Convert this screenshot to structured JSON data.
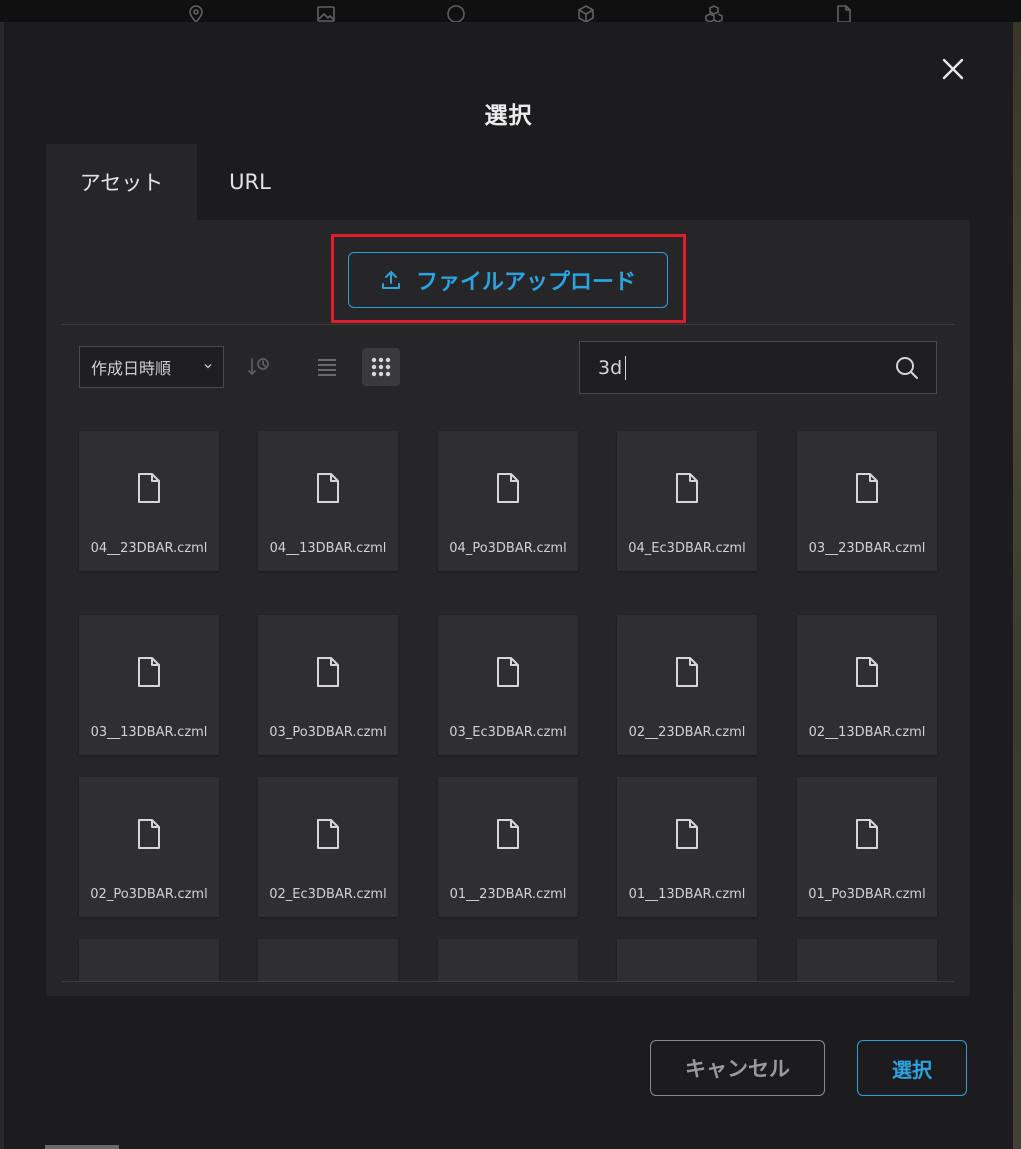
{
  "background": {
    "toolbar_icons": [
      "map-pin-icon",
      "image-icon",
      "circle-icon",
      "box-icon",
      "cubes-icon",
      "file-icon"
    ]
  },
  "modal": {
    "title": "選択",
    "tabs": [
      {
        "label": "アセット",
        "active": true
      },
      {
        "label": "URL",
        "active": false
      }
    ],
    "upload_label": "ファイルアップロード",
    "sort": {
      "selected": "作成日時順"
    },
    "search": {
      "value": "3d",
      "placeholder": ""
    },
    "files": [
      "04__23DBAR.czml",
      "04__13DBAR.czml",
      "04_Po3DBAR.czml",
      "04_Ec3DBAR.czml",
      "03__23DBAR.czml",
      "03__13DBAR.czml",
      "03_Po3DBAR.czml",
      "03_Ec3DBAR.czml",
      "02__23DBAR.czml",
      "02__13DBAR.czml",
      "02_Po3DBAR.czml",
      "02_Ec3DBAR.czml",
      "01__23DBAR.czml",
      "01__13DBAR.czml",
      "01_Po3DBAR.czml",
      "",
      "",
      "",
      "",
      ""
    ],
    "cancel_label": "キャンセル",
    "select_label": "選択"
  },
  "colors": {
    "accent": "#2aa3e0",
    "highlight": "#e01e2b",
    "modal_bg": "#1c1c1e",
    "panel_bg": "#262628",
    "card_bg": "#2f2f31"
  }
}
